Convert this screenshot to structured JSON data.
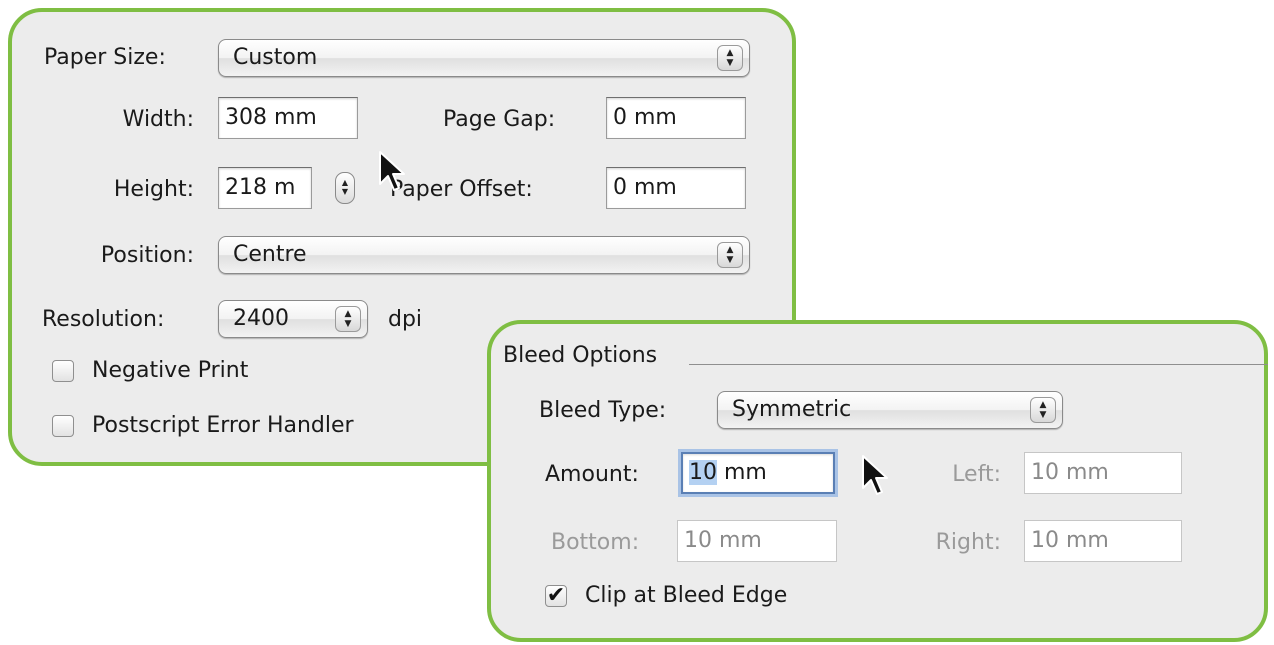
{
  "print_setup": {
    "paper_size": {
      "label": "Paper Size:",
      "value": "Custom"
    },
    "width": {
      "label": "Width:",
      "value": "308 mm"
    },
    "page_gap": {
      "label": "Page Gap:",
      "value": "0 mm"
    },
    "height": {
      "label": "Height:",
      "value": "218 m"
    },
    "paper_offset": {
      "label": "Paper Offset:",
      "value": "0 mm"
    },
    "position": {
      "label": "Position:",
      "value": "Centre"
    },
    "resolution": {
      "label": "Resolution:",
      "value": "2400",
      "unit": "dpi"
    },
    "negative_print": {
      "label": "Negative Print",
      "checked": false
    },
    "postscript_error_handler": {
      "label": "Postscript Error Handler",
      "checked": false
    }
  },
  "bleed_options": {
    "title": "Bleed Options",
    "bleed_type": {
      "label": "Bleed Type:",
      "value": "Symmetric"
    },
    "amount": {
      "label": "Amount:",
      "value_selected": "10",
      "value_rest": " mm"
    },
    "left": {
      "label": "Left:",
      "value": "10 mm"
    },
    "bottom": {
      "label": "Bottom:",
      "value": "10 mm"
    },
    "right": {
      "label": "Right:",
      "value": "10 mm"
    },
    "clip_at_bleed_edge": {
      "label": "Clip at Bleed Edge",
      "checked": true
    }
  },
  "colors": {
    "panel_border": "#7fbe43",
    "panel_bg": "#ececec",
    "focus_ring": "#a9c3e6"
  },
  "icons": [
    "popup-arrows-icon",
    "stepper-icon",
    "checkmark-icon",
    "mouse-pointer-icon"
  ]
}
